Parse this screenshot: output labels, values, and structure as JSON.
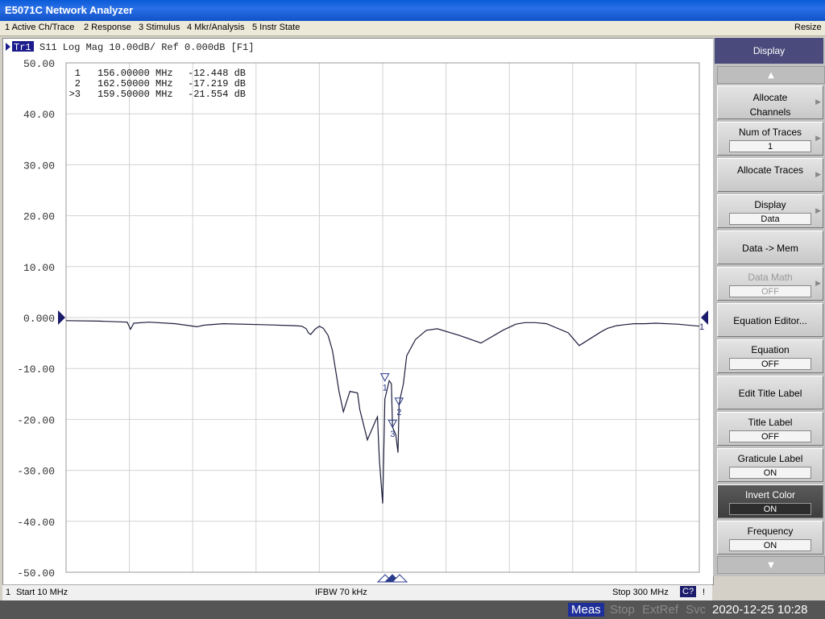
{
  "window": {
    "title": "E5071C Network Analyzer"
  },
  "menu": {
    "items": [
      "1 Active Ch/Trace",
      "2 Response",
      "3 Stimulus",
      "4 Mkr/Analysis",
      "5 Instr State"
    ],
    "resize": "Resize"
  },
  "trace_header": {
    "tag": "Tr1",
    "text": "S11 Log Mag 10.00dB/ Ref 0.000dB [F1]"
  },
  "markers": [
    {
      "label": "1",
      "freq": "156.00000 MHz",
      "value": "-12.448 dB"
    },
    {
      "label": "2",
      "freq": "162.50000 MHz",
      "value": "-17.219 dB"
    },
    {
      "label": ">3",
      "freq": "159.50000 MHz",
      "value": "-21.554 dB"
    }
  ],
  "chart_data": {
    "type": "line",
    "title": "",
    "xlabel": "",
    "ylabel": "",
    "xlim": [
      10,
      300
    ],
    "ylim": [
      -50,
      50
    ],
    "x_unit": "MHz",
    "y_unit": "dB",
    "yticks": [
      "50.00",
      "40.00",
      "30.00",
      "20.00",
      "10.00",
      "0.000",
      "-10.00",
      "-20.00",
      "-30.00",
      "-40.00",
      "-50.00"
    ],
    "grid": true,
    "reference_level": 0,
    "trace_label": "1",
    "series": [
      {
        "x": [
          10,
          25,
          38,
          39.5,
          41,
          48,
          60,
          70,
          73,
          82,
          100,
          115,
          118,
          120,
          121,
          122,
          124,
          126,
          127.8,
          130,
          132,
          135,
          137,
          140,
          143.5,
          144.5,
          148,
          152,
          152.6,
          153.5,
          155,
          156,
          158,
          159,
          159.5,
          161,
          162,
          162.5,
          163.2,
          164.5,
          166,
          170,
          175,
          180,
          190,
          200,
          210,
          216,
          220,
          225,
          230,
          240,
          245,
          255,
          258,
          262,
          266,
          270,
          275,
          280,
          290,
          300
        ],
        "y": [
          -0.6,
          -0.7,
          -0.9,
          -2.3,
          -1.1,
          -0.9,
          -1.2,
          -1.8,
          -1.5,
          -1.2,
          -1.4,
          -1.6,
          -1.7,
          -2.2,
          -3.0,
          -3.3,
          -2.3,
          -1.7,
          -2.1,
          -3.5,
          -6.5,
          -14.5,
          -18.5,
          -14.5,
          -14.8,
          -18,
          -24,
          -20,
          -19.5,
          -28,
          -36.5,
          -16.0,
          -12.4,
          -13,
          -21.5,
          -23,
          -26.5,
          -17.2,
          -15.5,
          -13,
          -7.5,
          -4.3,
          -2.5,
          -2.2,
          -3.5,
          -5.0,
          -2.5,
          -1.3,
          -1.0,
          -1.0,
          -1.2,
          -3.0,
          -5.5,
          -2.8,
          -2.1,
          -1.6,
          -1.4,
          -1.2,
          -1.2,
          -1.1,
          -1.3,
          -1.7
        ]
      }
    ]
  },
  "marker_points": [
    {
      "label": "1",
      "x": 156.0,
      "y": -12.448
    },
    {
      "label": "3",
      "x": 159.5,
      "y": -21.554
    },
    {
      "label": "2",
      "x": 162.5,
      "y": -17.219
    }
  ],
  "softkeys": {
    "title": "Display",
    "keys": [
      {
        "label": "Allocate Channels",
        "submenu": true
      },
      {
        "label": "Num of Traces",
        "value": "1",
        "submenu": true
      },
      {
        "label": "Allocate Traces",
        "submenu": true
      },
      {
        "label": "Display",
        "value": "Data",
        "submenu": true
      },
      {
        "label": "Data -> Mem"
      },
      {
        "label": "Data Math",
        "value": "OFF",
        "submenu": true,
        "disabled": true
      },
      {
        "label": "Equation Editor..."
      },
      {
        "label": "Equation",
        "value": "OFF"
      },
      {
        "label": "Edit Title Label"
      },
      {
        "label": "Title Label",
        "value": "OFF"
      },
      {
        "label": "Graticule Label",
        "value": "ON"
      },
      {
        "label": "Invert Color",
        "value": "ON",
        "active": true
      },
      {
        "label": "Frequency",
        "value": "ON"
      }
    ]
  },
  "status": {
    "channel": "1",
    "start": "Start 10 MHz",
    "ifbw": "IFBW 70 kHz",
    "stop": "Stop 300 MHz",
    "cal": "C?",
    "excl": "!"
  },
  "bottom": {
    "meas": "Meas",
    "stop": "Stop",
    "extref": "ExtRef",
    "svc": "Svc",
    "datetime": "2020-12-25 10:28"
  },
  "colors": {
    "trace": "#1c1c3c",
    "grid": "#d2d2d2",
    "marker": "#2a3a8c",
    "softkey_title": "#4a4a7c",
    "titlebar": "#1152c8"
  }
}
